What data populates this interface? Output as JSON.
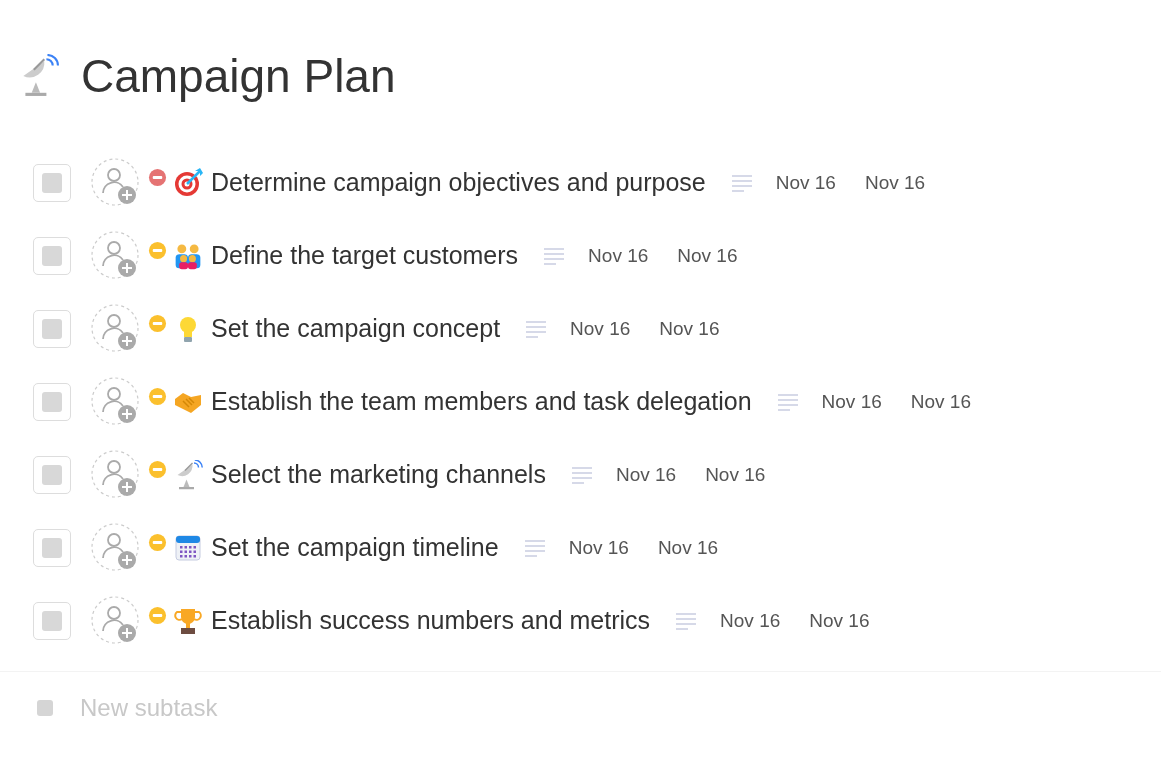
{
  "title": "Campaign Plan",
  "tasks": [
    {
      "name": "Determine campaign objectives and purpose",
      "done": false,
      "color": "#e57373",
      "kind": "target",
      "start": "Nov 16",
      "due": "Nov 16"
    },
    {
      "name": "Define the target customers",
      "done": false,
      "color": "#fbc02d",
      "kind": "family",
      "start": "Nov 16",
      "due": "Nov 16"
    },
    {
      "name": "Set the campaign concept",
      "done": false,
      "color": "#fbc02d",
      "kind": "bulb",
      "start": "Nov 16",
      "due": "Nov 16"
    },
    {
      "name": "Establish the team members and task delegation",
      "done": false,
      "color": "#fbc02d",
      "kind": "handshake",
      "start": "Nov 16",
      "due": "Nov 16"
    },
    {
      "name": "Select the marketing channels",
      "done": false,
      "color": "#fbc02d",
      "kind": "satellite",
      "start": "Nov 16",
      "due": "Nov 16"
    },
    {
      "name": "Set the campaign timeline",
      "done": false,
      "color": "#fbc02d",
      "kind": "calendar",
      "start": "Nov 16",
      "due": "Nov 16"
    },
    {
      "name": "Establish success numbers and metrics",
      "done": false,
      "color": "#fbc02d",
      "kind": "trophy",
      "start": "Nov 16",
      "due": "Nov 16"
    }
  ],
  "new_subtask": {
    "placeholder": "New subtask"
  }
}
